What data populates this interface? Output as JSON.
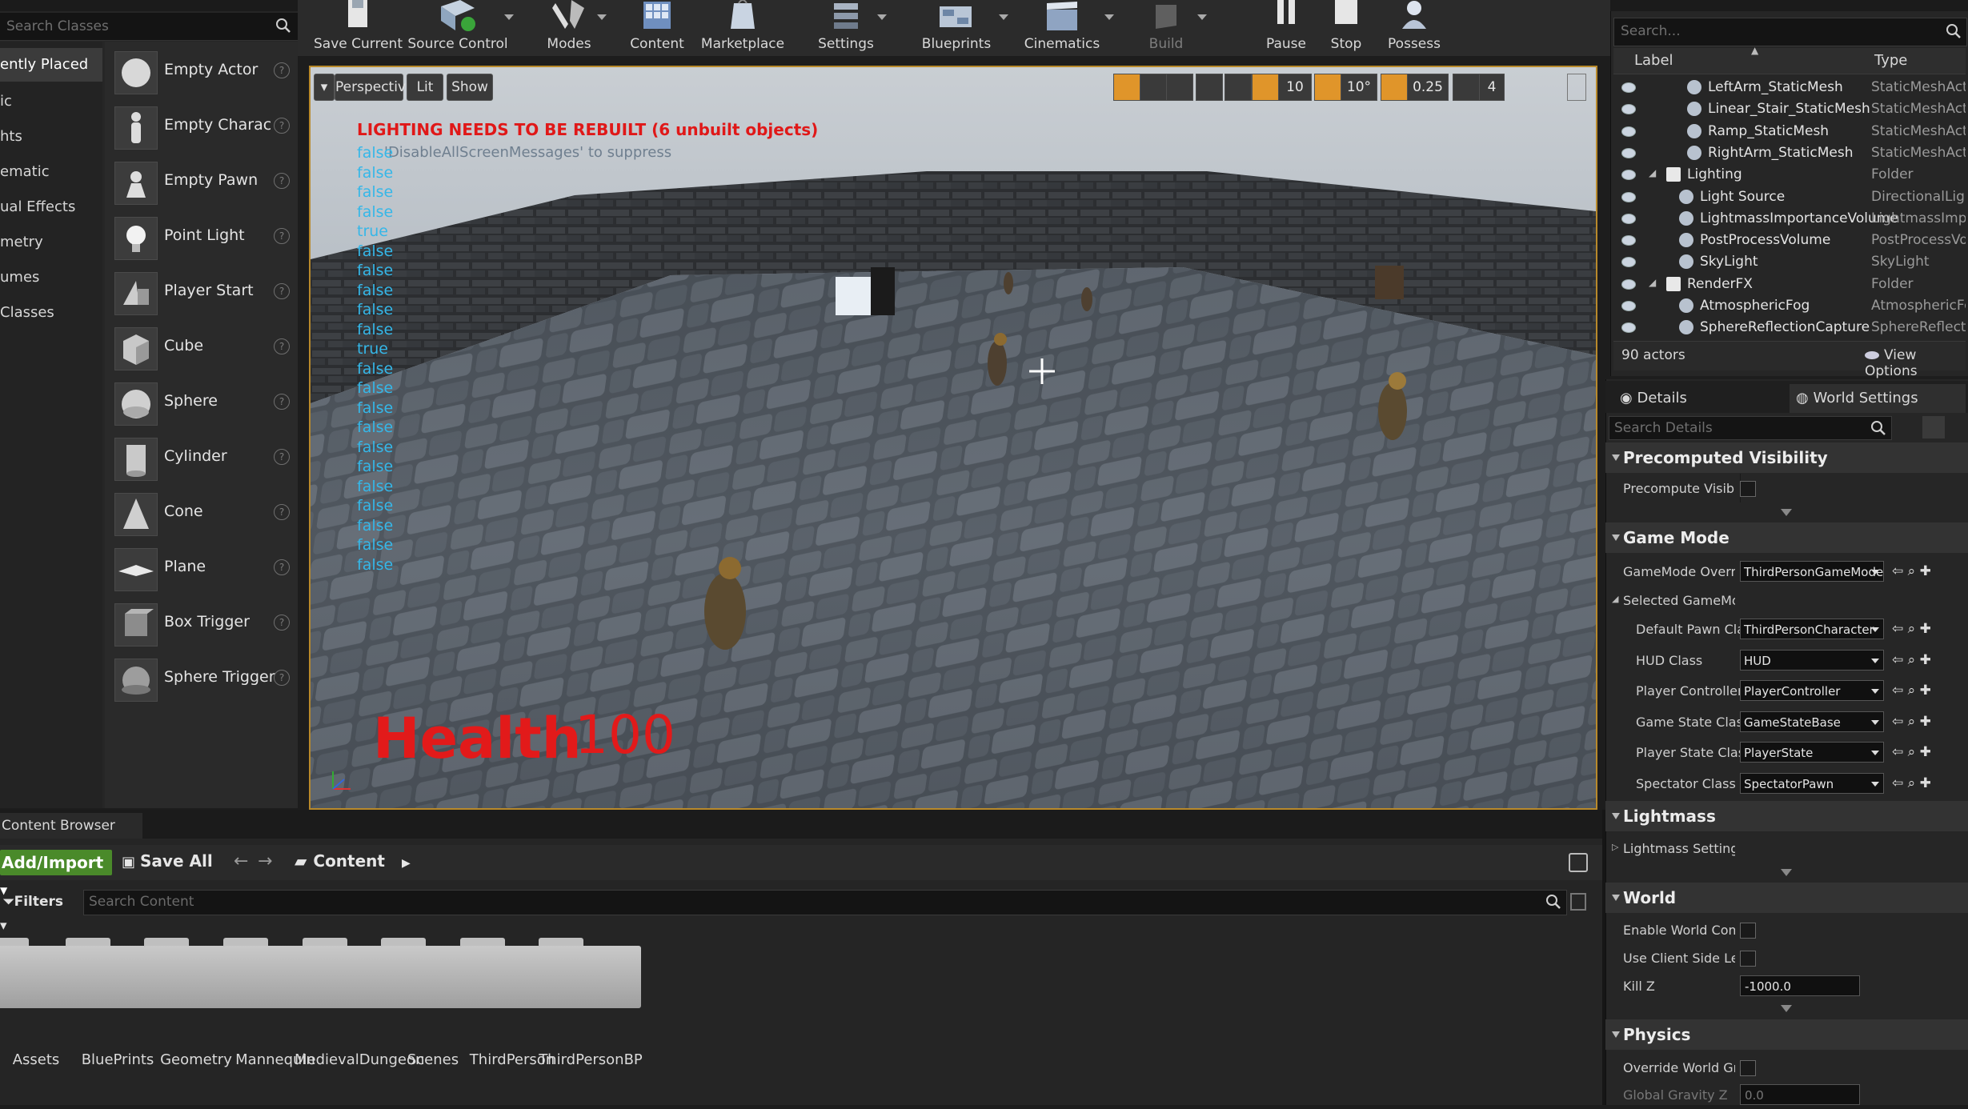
{
  "place_panel": {
    "search_placeholder": "Search Classes",
    "categories": [
      "ently Placed",
      "ic",
      "hts",
      "ematic",
      "ual Effects",
      "metry",
      "umes",
      "Classes"
    ],
    "items": [
      "Empty Actor",
      "Empty Charac",
      "Empty Pawn",
      "Point Light",
      "Player Start",
      "Cube",
      "Sphere",
      "Cylinder",
      "Cone",
      "Plane",
      "Box Trigger",
      "Sphere Trigger"
    ],
    "help_glyph": "?"
  },
  "toolbar": {
    "buttons": [
      "Save Current",
      "Source Control",
      "Modes",
      "Content",
      "Marketplace",
      "Settings",
      "Blueprints",
      "Cinematics",
      "Build",
      "Pause",
      "Stop",
      "Possess"
    ]
  },
  "viewport": {
    "perspective_label": "Perspective",
    "lit_label": "Lit",
    "show_label": "Show",
    "grid_snap": "10",
    "rotation_snap": "10°",
    "scale_snap": "0.25",
    "camera_speed": "4",
    "warning": "LIGHTING NEEDS TO BE REBUILT (6 unbuilt objects)",
    "suppress_hint": "'DisableAllScreenMessages' to suppress",
    "debug_values": [
      "false",
      "false",
      "false",
      "false",
      "true",
      "false",
      "false",
      "false",
      "false",
      "false",
      "true",
      "false",
      "false",
      "false",
      "false",
      "false",
      "false",
      "false",
      "false",
      "false",
      "false",
      "false"
    ],
    "health_label": "Health",
    "health_value": "100"
  },
  "outliner": {
    "search_placeholder": "Search...",
    "col_label": "Label",
    "col_type": "Type",
    "rows": [
      {
        "name": "LeftArm_StaticMesh",
        "type": "StaticMeshActor"
      },
      {
        "name": "Linear_Stair_StaticMesh",
        "type": "StaticMeshActor"
      },
      {
        "name": "Ramp_StaticMesh",
        "type": "StaticMeshActor"
      },
      {
        "name": "RightArm_StaticMesh",
        "type": "StaticMeshActor"
      },
      {
        "name": "Lighting",
        "type": "Folder"
      },
      {
        "name": "Light Source",
        "type": "DirectionalLight"
      },
      {
        "name": "LightmassImportanceVolume",
        "type": "LightmassImportanceVolume"
      },
      {
        "name": "PostProcessVolume",
        "type": "PostProcessVolume"
      },
      {
        "name": "SkyLight",
        "type": "SkyLight"
      },
      {
        "name": "RenderFX",
        "type": "Folder"
      },
      {
        "name": "AtmosphericFog",
        "type": "AtmosphericFog"
      },
      {
        "name": "SphereReflectionCapture",
        "type": "SphereReflectionCapture"
      }
    ],
    "actor_count": "90 actors",
    "view_options": "View Options"
  },
  "details": {
    "tab_details": "Details",
    "tab_world_settings": "World Settings",
    "search_placeholder": "Search Details",
    "sections": {
      "precomputed": "Precomputed Visibility",
      "game_mode": "Game Mode",
      "lightmass": "Lightmass",
      "world": "World",
      "physics": "Physics"
    },
    "props": {
      "precompute_visibility": "Precompute Visibili",
      "gamemode_override": "GameMode Overric",
      "gamemode_override_value": "ThirdPersonGameMode",
      "selected_gamemode": "Selected GameMo",
      "default_pawn": "Default Pawn Cla",
      "default_pawn_value": "ThirdPersonCharacter",
      "hud_class": "HUD Class",
      "hud_class_value": "HUD",
      "player_controller": "Player Controller",
      "player_controller_value": "PlayerController",
      "game_state": "Game State Clas",
      "game_state_value": "GameStateBase",
      "player_state": "Player State Clas",
      "player_state_value": "PlayerState",
      "spectator": "Spectator Class",
      "spectator_value": "SpectatorPawn",
      "lightmass_settings": "Lightmass Settings",
      "enable_world_comp": "Enable World Comp",
      "use_client_side": "Use Client Side Lev",
      "kill_z": "Kill Z",
      "kill_z_value": "-1000.0",
      "override_world_gravity": "Override World Gra",
      "global_gravity_z": "Global Gravity Z",
      "global_gravity_z_value": "0.0"
    }
  },
  "content_browser": {
    "tab_label": "Content Browser",
    "add_import": "Add/Import",
    "save_all": "Save All",
    "path": "Content",
    "filters": "Filters",
    "search_placeholder": "Search Content",
    "folders": [
      "Assets",
      "BluePrints",
      "Geometry",
      "Mannequin",
      "MedievalDungeon",
      "Scenes",
      "ThirdPerson",
      "ThirdPersonBP"
    ]
  },
  "colors": {
    "accent_orange": "#e0952a",
    "warning_red": "#e01818",
    "debug_blue": "#35b7e8",
    "add_green": "#4a8a2a"
  }
}
